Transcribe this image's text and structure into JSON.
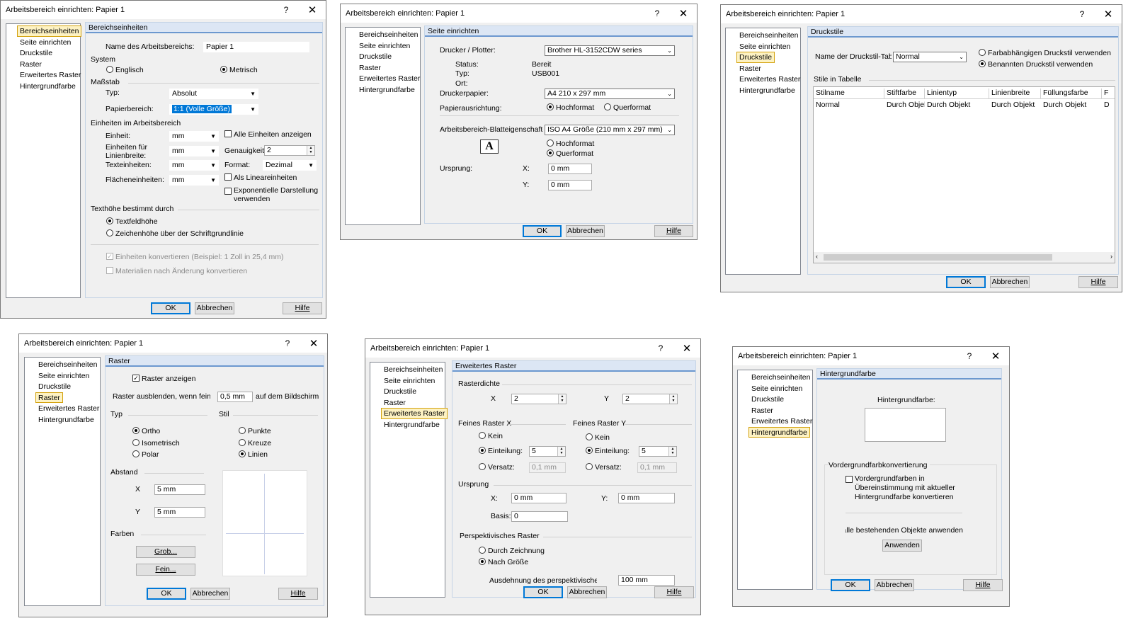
{
  "dialog_title": "Arbeitsbereich einrichten: Papier 1",
  "title_help": "?",
  "title_close": "✕",
  "nav": {
    "bereichseinheiten": "Bereichseinheiten",
    "seite": "Seite einrichten",
    "druckstile": "Druckstile",
    "raster": "Raster",
    "erweitert": "Erweitertes Raster",
    "hintergrund": "Hintergrundfarbe"
  },
  "buttons": {
    "ok": "OK",
    "abbrechen": "Abbrechen",
    "hilfe": "Hilfe"
  },
  "d1": {
    "header": "Bereichseinheiten",
    "name_label": "Name des Arbeitsbereichs:",
    "name_value": "Papier 1",
    "system_label": "System",
    "englisch": "Englisch",
    "metrisch": "Metrisch",
    "massstab": "Maßstab",
    "typ_label": "Typ:",
    "typ_value": "Absolut",
    "papier_label": "Papierbereich:",
    "papier_value": "1:1 (Volle Größe)",
    "einheiten_heading": "Einheiten im Arbeitsbereich",
    "einheit_label": "Einheit:",
    "einheit_value": "mm",
    "alle_einheiten": "Alle Einheiten anzeigen",
    "linienbreite_label": "Einheiten für Linienbreite:",
    "linienbreite_value": "mm",
    "genauigkeit_label": "Genauigkeit:",
    "genauigkeit_value": "2",
    "text_label": "Texteinheiten:",
    "text_value": "mm",
    "format_label": "Format:",
    "format_value": "Dezimal",
    "flaechen_label": "Flächeneinheiten:",
    "flaechen_value": "mm",
    "als_linear": "Als Lineareinheiten",
    "exponentiell": "Exponentielle Darstellung verwenden",
    "texthoehe_label": "Texthöhe bestimmt durch",
    "textfeldhoehe": "Textfeldhöhe",
    "zeichenhoehe": "Zeichenhöhe über der Schriftgrundlinie",
    "konvertieren": "Einheiten konvertieren (Beispiel: 1 Zoll in 25,4 mm)",
    "materialien": "Materialien nach Änderung konvertieren"
  },
  "d2": {
    "header": "Seite einrichten",
    "drucker_label": "Drucker / Plotter:",
    "drucker_value": "Brother HL-3152CDW series",
    "status_label": "Status:",
    "status_value": "Bereit",
    "typ_label": "Typ:",
    "typ_value": "USB001",
    "ort_label": "Ort:",
    "papier_label": "Druckerpapier:",
    "papier_value": "A4 210 x 297 mm",
    "ausrichtung_label": "Papierausrichtung:",
    "hochformat": "Hochformat",
    "querformat": "Querformat",
    "blatt_label": "Arbeitsbereich-Blatteigenschaften:",
    "blatt_value": "ISO A4 Größe (210 mm x 297 mm)",
    "hochformat2": "Hochformat",
    "querformat2": "Querformat",
    "ursprung_label": "Ursprung:",
    "x_label": "X:",
    "x_value": "0 mm",
    "y_label": "Y:",
    "y_value": "0 mm",
    "glyph": "A"
  },
  "d3": {
    "header": "Druckstile",
    "name_label": "Name der Druckstil-Tabelle:",
    "name_value": "Normal",
    "farb": "Farbabhängigen Druckstil verwenden",
    "benannt": "Benannten Druckstil verwenden",
    "stile_label": "Stile in Tabelle",
    "columns": [
      "Stilname",
      "Stiftfarbe",
      "Linientyp",
      "Linienbreite",
      "Füllungsfarbe",
      "F"
    ],
    "row": [
      "Normal",
      "Durch Objekt",
      "Durch Objekt",
      "Durch Objekt",
      "Durch Objekt",
      "D"
    ]
  },
  "d4": {
    "header": "Raster",
    "anzeigen": "Raster anzeigen",
    "ausblenden_label": "Raster ausblenden, wenn feiner als",
    "ausblenden_value": "0,5 mm",
    "bildschirm": "auf dem Bildschirm",
    "typ_label": "Typ",
    "stil_label": "Stil",
    "ortho": "Ortho",
    "isometrisch": "Isometrisch",
    "polar": "Polar",
    "punkte": "Punkte",
    "kreuze": "Kreuze",
    "linien": "Linien",
    "abstand_label": "Abstand",
    "x_label": "X",
    "x_value": "5 mm",
    "y_label": "Y",
    "y_value": "5 mm",
    "farben_label": "Farben",
    "grob": "Grob...",
    "fein": "Fein..."
  },
  "d5": {
    "header": "Erweitertes Raster",
    "rasterdichte": "Rasterdichte",
    "x_label": "X",
    "x_value": "2",
    "y_label": "Y",
    "y_value": "2",
    "feinx": "Feines Raster X",
    "feiny": "Feines Raster Y",
    "kein": "Kein",
    "einteilung": "Einteilung:",
    "einteilung_value": "5",
    "versatz": "Versatz:",
    "versatz_value": "0,1 mm",
    "ursprung_label": "Ursprung",
    "ux_label": "X:",
    "ux_value": "0 mm",
    "uy_label": "Y:",
    "uy_value": "0 mm",
    "basis_label": "Basis:",
    "basis_value": "0",
    "perspektivisch": "Perspektivisches Raster",
    "durch_zeichnung": "Durch Zeichnung",
    "nach_groesse": "Nach Größe",
    "ausdehnung_label": "Ausdehnung des perspektivischen Rasters:",
    "ausdehnung_value": "100 mm"
  },
  "d6": {
    "header": "Hintergrundfarbe",
    "hintergrund_label": "Hintergrundfarbe:",
    "vordergrund_heading": "Vordergrundfarbkonvertierung",
    "vordergrund_cb": "Vordergrundfarben in Übereinstimmung mit aktueller Hintergrundfarbe konvertieren",
    "alle_objekte": "Auf alle bestehenden Objekte anwenden",
    "anwenden": "Anwenden"
  }
}
